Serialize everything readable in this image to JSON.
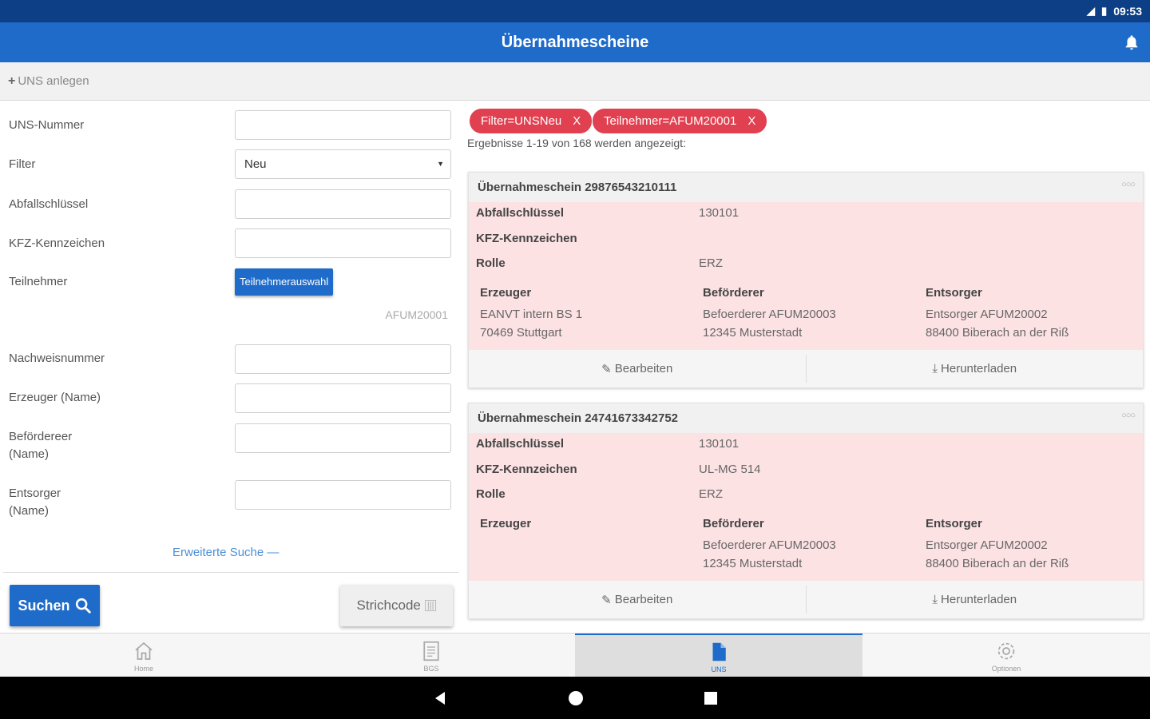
{
  "status_bar": {
    "time": "09:53"
  },
  "app_bar": {
    "title": "Übernahmescheine"
  },
  "toolbar": {
    "create_label": "UNS anlegen"
  },
  "form": {
    "fields": [
      {
        "label": "UNS-Nummer"
      },
      {
        "label": "Filter",
        "value": "Neu"
      },
      {
        "label": "Abfallschlüssel"
      },
      {
        "label": "KFZ-Kennzeichen"
      },
      {
        "label": "Teilnehmer",
        "button": "Teilnehmerauswahl",
        "selected": "AFUM20001"
      },
      {
        "label": "Nachweisnummer"
      },
      {
        "label": "Erzeuger (Name)"
      },
      {
        "label_line1": "Befördereer",
        "label_line2": "(Name)"
      },
      {
        "label_line1": "Entsorger",
        "label_line2": "(Name)"
      }
    ],
    "extended_search": "Erweiterte Suche",
    "search_button": "Suchen",
    "barcode_button": "Strichcode"
  },
  "filters": [
    {
      "label": "Filter=UNSNeu",
      "remove": "X"
    },
    {
      "label": "Teilnehmer=AFUM20001",
      "remove": "X"
    }
  ],
  "results_info": "Ergebnisse 1-19 von 168 werden angezeigt:",
  "cards": [
    {
      "title": "Übernahmeschein 29876543210111",
      "rows": [
        {
          "label": "Abfallschlüssel",
          "value": "130101"
        },
        {
          "label": "KFZ-Kennzeichen",
          "value": ""
        },
        {
          "label": "Rolle",
          "value": "ERZ"
        }
      ],
      "cols": [
        {
          "head": "Erzeuger",
          "line1": "EANVT intern BS 1",
          "line2": "70469 Stuttgart"
        },
        {
          "head": "Beförderer",
          "line1": "Befoerderer AFUM20003",
          "line2": "12345 Musterstadt"
        },
        {
          "head": "Entsorger",
          "line1": "Entsorger AFUM20002",
          "line2": "88400 Biberach an der Riß"
        }
      ],
      "edit": "Bearbeiten",
      "download": "Herunterladen"
    },
    {
      "title": "Übernahmeschein 24741673342752",
      "rows": [
        {
          "label": "Abfallschlüssel",
          "value": "130101"
        },
        {
          "label": "KFZ-Kennzeichen",
          "value": "UL-MG 514"
        },
        {
          "label": "Rolle",
          "value": "ERZ"
        }
      ],
      "cols": [
        {
          "head": "Erzeuger",
          "line1": "",
          "line2": ""
        },
        {
          "head": "Beförderer",
          "line1": "Befoerderer AFUM20003",
          "line2": "12345 Musterstadt"
        },
        {
          "head": "Entsorger",
          "line1": "Entsorger AFUM20002",
          "line2": "88400 Biberach an der Riß"
        }
      ],
      "edit": "Bearbeiten",
      "download": "Herunterladen"
    }
  ],
  "bottom_nav": [
    {
      "label": "Home",
      "icon": "home-icon"
    },
    {
      "label": "BGS",
      "icon": "document-icon"
    },
    {
      "label": "UNS",
      "icon": "file-icon",
      "active": true
    },
    {
      "label": "Optionen",
      "icon": "gear-icon"
    }
  ],
  "colors": {
    "primary": "#1f6bc9",
    "status_bar": "#0d3f86",
    "chip": "#e0404f",
    "card_body": "#fde2e4"
  }
}
